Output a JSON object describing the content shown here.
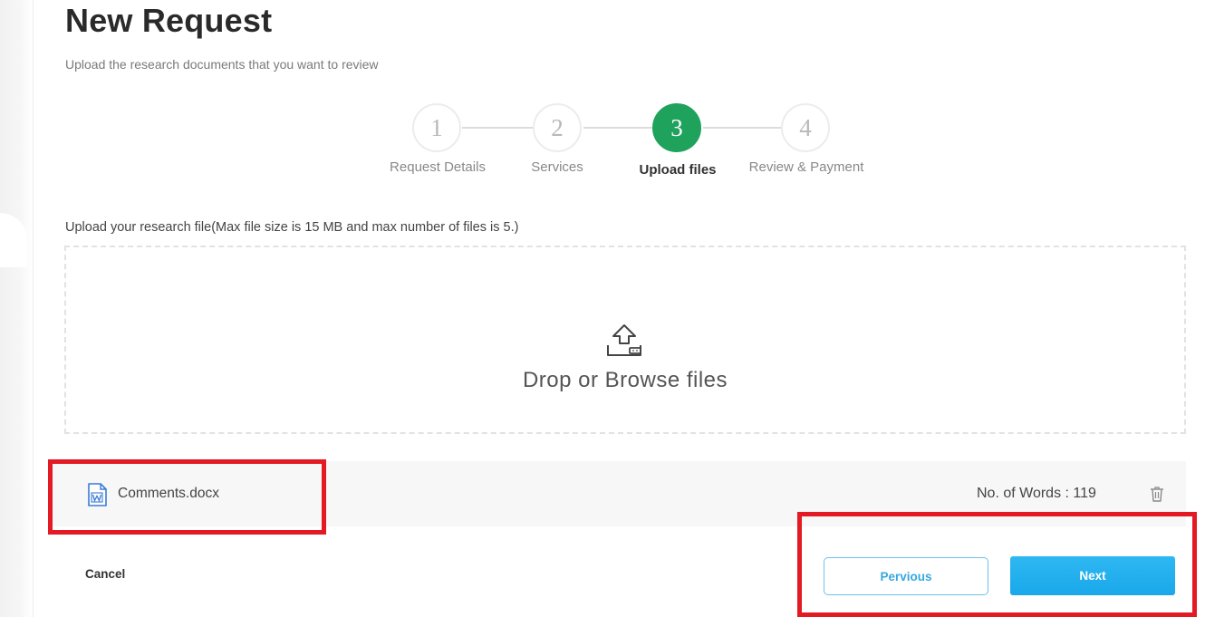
{
  "page": {
    "title": "New Request",
    "subtitle": "Upload the research documents that you want to review"
  },
  "stepper": {
    "steps": [
      {
        "number": "1",
        "label": "Request Details",
        "state": "inactive"
      },
      {
        "number": "2",
        "label": "Services",
        "state": "inactive"
      },
      {
        "number": "3",
        "label": "Upload files",
        "state": "active"
      },
      {
        "number": "4",
        "label": "Review & Payment",
        "state": "inactive"
      }
    ],
    "active_color": "#1ea25c"
  },
  "upload": {
    "instructions": "Upload your research file(Max file size is 15 MB and max number of files is 5.)",
    "dropzone_text": "Drop or Browse files",
    "icon": "upload-icon"
  },
  "files": [
    {
      "name": "Comments.docx",
      "word_count_text": "No. of Words : 119",
      "icon": "word-doc-icon"
    }
  ],
  "actions": {
    "cancel": "Cancel",
    "previous": "Pervious",
    "next": "Next"
  },
  "colors": {
    "accent_blue": "#1aa8ea",
    "highlight_red": "#e31a23"
  }
}
